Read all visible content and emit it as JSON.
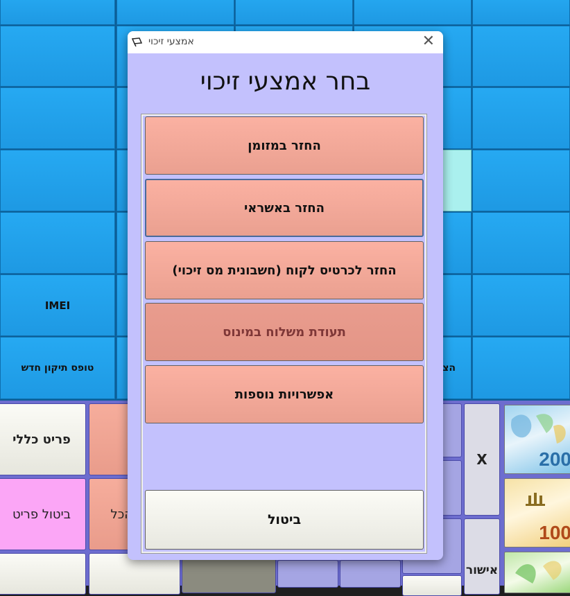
{
  "grid": {
    "imei_label": "IMEI",
    "new_repair_form_label": "טופס תיקון חדש",
    "partial_right_label": "הצ"
  },
  "pos": {
    "general_item_label": "פריט כללי",
    "cancel_item_label": "ביטול פריט",
    "partial_all_label": "הכל",
    "x_button_label": "X",
    "confirm_button_label": "אישור",
    "bill_200_label": "200",
    "bill_100_label": "100"
  },
  "dialog": {
    "window_title": "אמצעי זיכוי",
    "heading": "בחר אמצעי זיכוי",
    "options": [
      {
        "label": "החזר במזומן"
      },
      {
        "label": "החזר באשראי"
      },
      {
        "label": "החזר לכרטיס לקוח (חשבונית מס זיכוי)"
      },
      {
        "label": "תעודת משלוח במינוס"
      },
      {
        "label": "אפשרויות נוספות"
      }
    ],
    "cancel_label": "ביטול"
  },
  "colors": {
    "tile_blue": "#26a9f2",
    "dialog_bg": "#c3c1fd",
    "option_salmon": "#f6ad9c",
    "cancel_white": "#f5f5ee"
  }
}
